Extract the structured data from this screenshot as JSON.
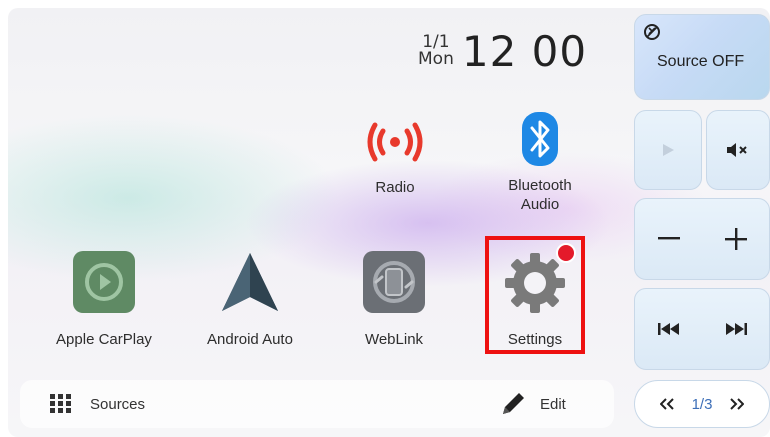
{
  "clock": {
    "date": "1/1",
    "day": "Mon",
    "time": "12 00"
  },
  "apps": {
    "radio": {
      "label": "Radio"
    },
    "bluetooth_audio": {
      "label_line1": "Bluetooth",
      "label_line2": "Audio"
    },
    "apple_carplay": {
      "label": "Apple CarPlay"
    },
    "android_auto": {
      "label": "Android Auto"
    },
    "weblink": {
      "label": "WebLink"
    },
    "settings": {
      "label": "Settings"
    }
  },
  "bottom_bar": {
    "sources_label": "Sources",
    "edit_label": "Edit"
  },
  "side_panel": {
    "source_off_label": "Source OFF",
    "page_indicator": "1/3"
  },
  "icons": {
    "radio": "radio-broadcast-icon",
    "bluetooth": "bluetooth-icon",
    "carplay": "carplay-icon",
    "android_auto": "android-auto-icon",
    "weblink": "weblink-icon",
    "settings": "gear-icon",
    "sources": "grid-icon",
    "edit": "pencil-icon"
  },
  "colors": {
    "radio_red": "#e8392c",
    "bluetooth_blue": "#1e88e5",
    "highlight_red": "#ee1111",
    "badge_red": "#e41a2a",
    "page_indicator_blue": "#3d6fb8"
  }
}
